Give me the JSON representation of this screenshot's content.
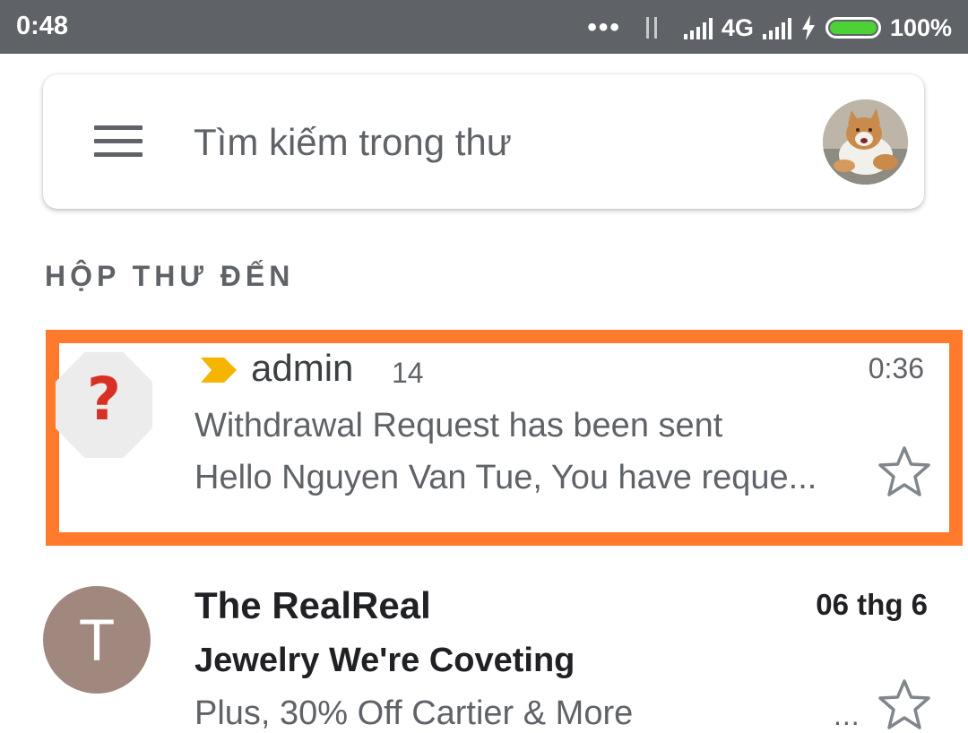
{
  "status_bar": {
    "time": "0:48",
    "dots": "•••",
    "network": "4G",
    "battery": "100%",
    "battery_level": 1.0,
    "battery_color": "#4cd137"
  },
  "search": {
    "menu_icon": "menu-icon",
    "placeholder": "Tìm kiếm trong thư",
    "avatar_icon": "profile-avatar-cat"
  },
  "inbox": {
    "label": "HỘP THƯ ĐẾN",
    "emails": [
      {
        "avatar_symbol": "?",
        "important_icon": "importance-marker-icon",
        "sender": "admin",
        "count": "14",
        "time": "0:36",
        "subject": "Withdrawal Request has been sent",
        "snippet": "Hello Nguyen Van Tue, You have reque...",
        "starred": false,
        "highlight_color": "#ff7a2d"
      },
      {
        "avatar_letter": "T",
        "avatar_color": "#a1887f",
        "sender": "The RealReal",
        "time": "06 thg 6",
        "subject": "Jewelry We're Coveting",
        "snippet": "Plus, 30% Off Cartier & More",
        "ellipsis": "...",
        "starred": false,
        "unread": true
      }
    ]
  }
}
